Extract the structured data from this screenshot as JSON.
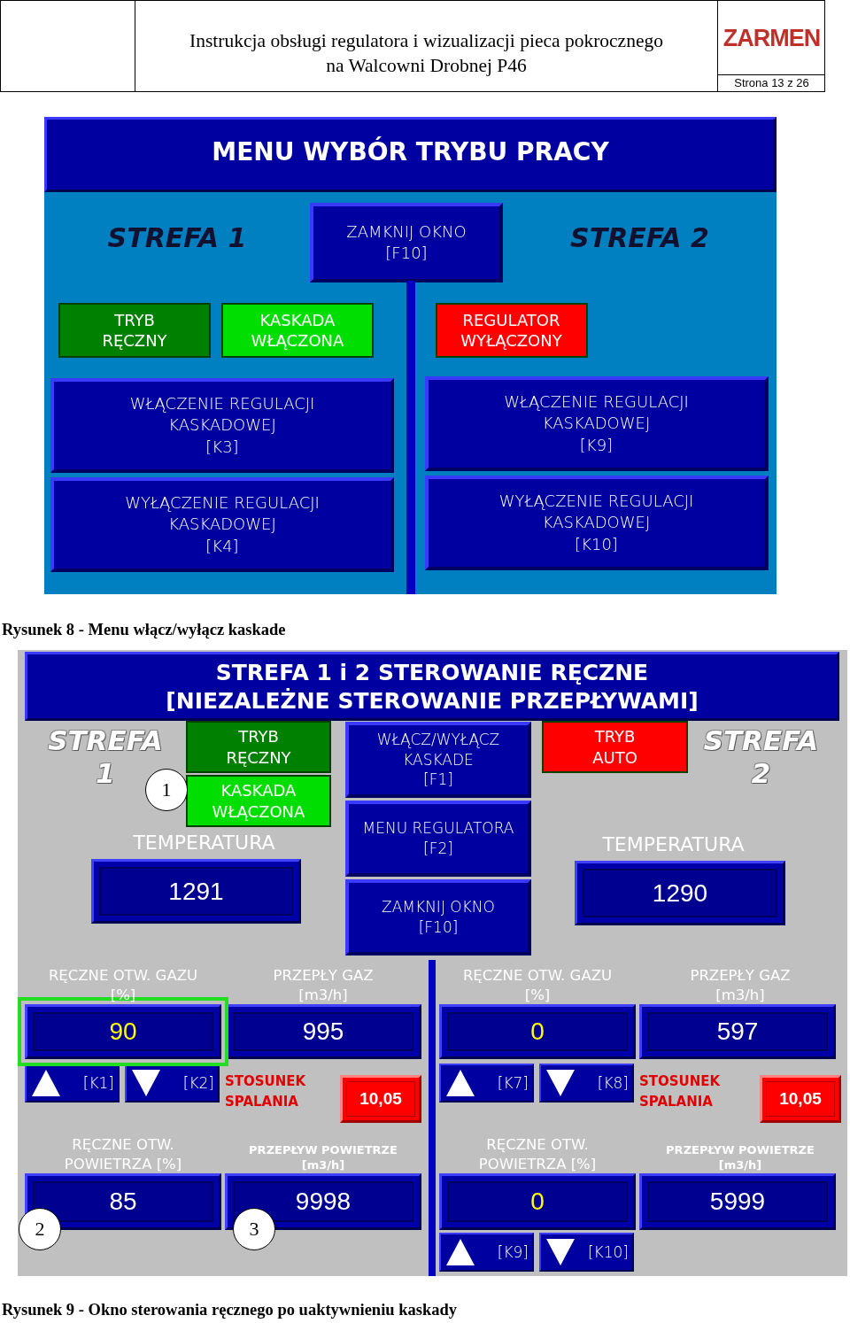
{
  "header": {
    "title": "Instrukcja obsługi regulatora i wizualizacji pieca pokrocznego\nna Walcowni Drobnej P46",
    "logo": "ZARMEN",
    "page": "Strona 13 z 26"
  },
  "figure_1": {
    "title": "MENU WYBÓR TRYBU PRACY",
    "zones": [
      "STREFA 1",
      "STREFA 2"
    ],
    "close_button": "ZAMKNIJ OKNO\n[F10]",
    "halves": [
      {
        "statuses": [
          {
            "label": "TRYB\nRĘCZNY",
            "color": "#008000"
          },
          {
            "label": "KASKADA\nWŁĄCZONA",
            "color": "#00dd00"
          }
        ],
        "buttons": [
          "WŁĄCZENIE REGULACJI\nKASKADOWEJ\n[K3]",
          "WYŁĄCZENIE REGULACJI\nKASKADOWEJ\n[K4]"
        ]
      },
      {
        "statuses": [
          {
            "label": "REGULATOR\nWYŁĄCZONY",
            "color": "#ff0000"
          }
        ],
        "buttons": [
          "WŁĄCZENIE REGULACJI\nKASKADOWEJ\n[K9]",
          "WYŁĄCZENIE REGULACJI\nKASKADOWEJ\n[K10]"
        ]
      }
    ],
    "caption": "Rysunek 8 - Menu włącz/wyłącz kaskade"
  },
  "figure_2": {
    "title": "STREFA 1 i 2 STEROWANIE RĘCZNE\n[NIEZALEŻNE STEROWANIE PRZEPŁYWAMI]",
    "zones": [
      {
        "name": "STREFA\n1",
        "statuses": [
          {
            "label": "TRYB\nRĘCZNY",
            "color": "#008000"
          },
          {
            "label": "KASKADA\nWŁĄCZONA",
            "color": "#00dd00"
          }
        ],
        "temperature_label": "TEMPERATURA",
        "temperature": "1291"
      },
      {
        "name": "STREFA\n2",
        "statuses": [
          {
            "label": "TRYB\nAUTO",
            "color": "#ff0000"
          }
        ],
        "temperature_label": "TEMPERATURA",
        "temperature": "1290"
      }
    ],
    "middle_buttons": [
      "WŁĄCZ/WYŁĄCZ\nKASKADE\n[F1]",
      "MENU REGULATORA\n[F2]",
      "ZAMKNIJ OKNO\n[F10]"
    ],
    "sections": [
      {
        "gas_label": "RĘCZNE OTW. GAZU\n[%]",
        "gas_flow_label": "PRZEPŁY GAZ\n[m3/h]",
        "gas_value": {
          "text": "90",
          "editable": true,
          "highlighted": true
        },
        "gas_flow": "995",
        "gas_buttons": [
          {
            "kind": "up",
            "key": "[K1]"
          },
          {
            "kind": "down",
            "key": "[K2]"
          }
        ],
        "ratio_label": "STOSUNEK\nSPALANIA",
        "ratio": "10,05",
        "air_label": "RĘCZNE OTW.\nPOWIETRZA [%]",
        "air_flow_label": "PRZEPŁYW POWIETRZE\n[m3/h]",
        "air_value": {
          "text": "85",
          "editable": false
        },
        "air_flow": "9998"
      },
      {
        "gas_label": "RĘCZNE OTW. GAZU\n[%]",
        "gas_flow_label": "PRZEPŁY GAZ\n[m3/h]",
        "gas_value": {
          "text": "0",
          "editable": true,
          "highlighted": false
        },
        "gas_flow": "597",
        "gas_buttons": [
          {
            "kind": "up",
            "key": "[K7]"
          },
          {
            "kind": "down",
            "key": "[K8]"
          }
        ],
        "ratio_label": "STOSUNEK\nSPALANIA",
        "ratio": "10,05",
        "air_label": "RĘCZNE OTW.\nPOWIETRZA [%]",
        "air_flow_label": "PRZEPŁYW POWIETRZE\n[m3/h]",
        "air_value": {
          "text": "0",
          "editable": true
        },
        "air_flow": "5999",
        "air_buttons": [
          {
            "kind": "up",
            "key": "[K9]"
          },
          {
            "kind": "down",
            "key": "[K10]"
          }
        ]
      }
    ],
    "callouts": [
      "1",
      "2",
      "3"
    ],
    "caption": "Rysunek 9 - Okno sterowania ręcznego po uaktywnieniu kaskady"
  }
}
